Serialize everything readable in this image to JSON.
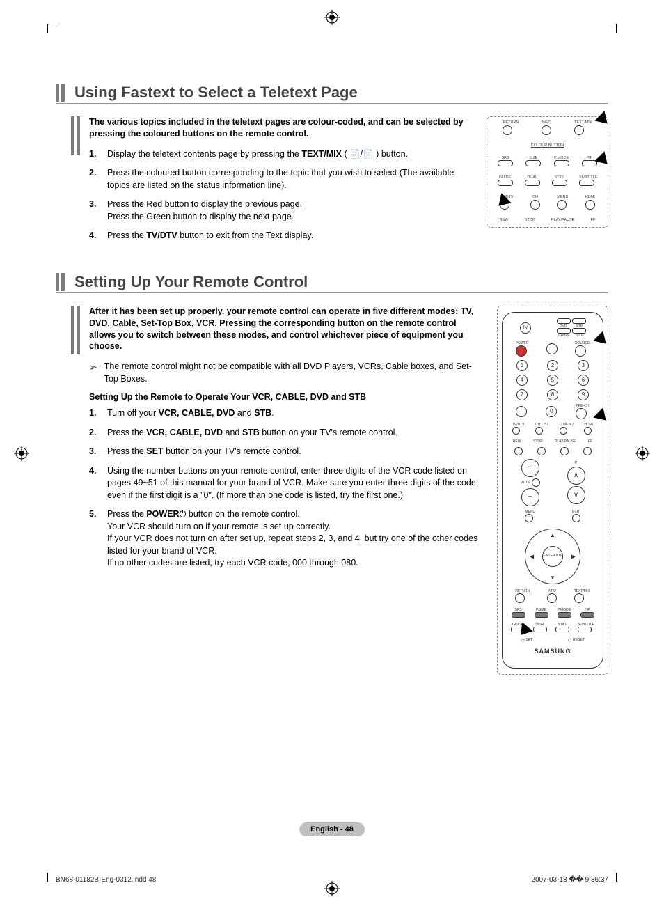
{
  "section1": {
    "title": "Using Fastext to Select a Teletext Page",
    "intro": "The various topics included in the teletext pages are colour-coded, and can be selected by pressing the coloured buttons on the remote control.",
    "steps": {
      "s1a": "Display the teletext contents page by pressing the ",
      "s1b": "TEXT/MIX",
      "s1c": " ( 📄/📄 ) button.",
      "s2": "Press the coloured button corresponding to the topic that you wish to select (The available topics are listed on the status information line).",
      "s3a": "Press the Red button to display the previous page.",
      "s3b": "Press the Green button to display the next page.",
      "s4a": "Press the ",
      "s4b": "TV/DTV",
      "s4c": " button to exit from the Text display."
    },
    "fig": {
      "r1": {
        "a": "RETURN",
        "b": "INFO",
        "c": "TEXT/MIX"
      },
      "r2": "COLOUR BUTTON",
      "r3": {
        "a": "SRS",
        "b": "SIZE",
        "c": "P.MODE",
        "d": "PIP"
      },
      "r4": {
        "a": "GUIDE",
        "b": "DUAL",
        "c": "STILL",
        "d": "SUBTITLE"
      },
      "r5": {
        "a": "TV/DTV",
        "b": "CH",
        "c": "MENU",
        "d": "HDMI"
      },
      "r6": {
        "a": "REW",
        "b": "STOP",
        "c": "PLAY/PAUSE",
        "d": "FF"
      }
    }
  },
  "section2": {
    "title": "Setting Up Your Remote Control",
    "intro": "After it has been set up properly, your remote control can operate in five different modes: TV, DVD, Cable, Set-Top Box, VCR. Pressing the corresponding button on the remote control allows you to switch between these modes, and control whichever piece of equipment you choose.",
    "note": "The remote control might not be compatible with all DVD Players, VCRs, Cable boxes, and Set-Top Boxes.",
    "subhead": "Setting Up the Remote to Operate Your VCR, CABLE, DVD and STB",
    "steps": {
      "s1a": "Turn off your ",
      "s1b": "VCR, CABLE, DVD",
      "s1c": " and ",
      "s1d": "STB",
      "s1e": ".",
      "s2a": "Press the ",
      "s2b": "VCR, CABLE, DVD",
      "s2c": " and ",
      "s2d": "STB",
      "s2e": " button on your TV's remote control.",
      "s3a": "Press the ",
      "s3b": "SET",
      "s3c": " button on your TV's remote control.",
      "s4": "Using the number buttons on your remote control, enter three digits of the VCR code listed on pages 49~51 of this manual for your brand of VCR. Make sure you enter three digits of the code, even if the first digit is a \"0\". (If more than one code is listed, try the first one.)",
      "s5a": "Press the ",
      "s5b": "POWER",
      "s5c": "  button on the remote control.",
      "s5d": "Your VCR should turn on if your remote is set up correctly.",
      "s5e": "If your VCR does not turn on after set up, repeat steps 2, 3, and 4, but try one of the other codes listed for your brand of VCR.",
      "s5f": "If no other codes are listed, try each VCR code, 000 through 080."
    },
    "remote": {
      "modes": {
        "tv": "TV",
        "dvd": "DVD",
        "stb": "STB",
        "cable": "CABLE",
        "vcr": "VCR"
      },
      "power": "POWER",
      "source": "SOURCE",
      "nums": [
        "1",
        "2",
        "3",
        "4",
        "5",
        "6",
        "7",
        "8",
        "9",
        "0"
      ],
      "prech": "PRE-CH",
      "row": {
        "tvdtv": "TV/DTV",
        "chlist": "CH LIST",
        "dmenu": "D.MENU",
        "hdmi": "HDMI"
      },
      "trans": {
        "rew": "REW",
        "stop": "STOP",
        "play": "PLAY/PAUSE",
        "ff": "FF"
      },
      "vol": "+",
      "voldn": "−",
      "mute": "MUTE",
      "chup": "∧",
      "chdn": "∨",
      "p": "P",
      "menu": "MENU",
      "exit": "EXIT",
      "enter": "ENTER /OK",
      "return": "RETURN",
      "info": "INFO",
      "textmix": "TEXT/MIX",
      "row2": {
        "srs": "SRS",
        "psize": "P.SIZE",
        "pmode": "P.MODE",
        "pip": "PIP"
      },
      "row3": {
        "guide": "GUIDE",
        "dual": "DUAL",
        "still": "STILL",
        "subtitle": "SUBTITLE"
      },
      "set": "SET",
      "reset": "RESET",
      "brand": "SAMSUNG"
    }
  },
  "page_label": "English - 48",
  "footer": {
    "left": "BN68-01182B-Eng-0312.indd   48",
    "right": "2007-03-13   �� 9:36:37"
  }
}
